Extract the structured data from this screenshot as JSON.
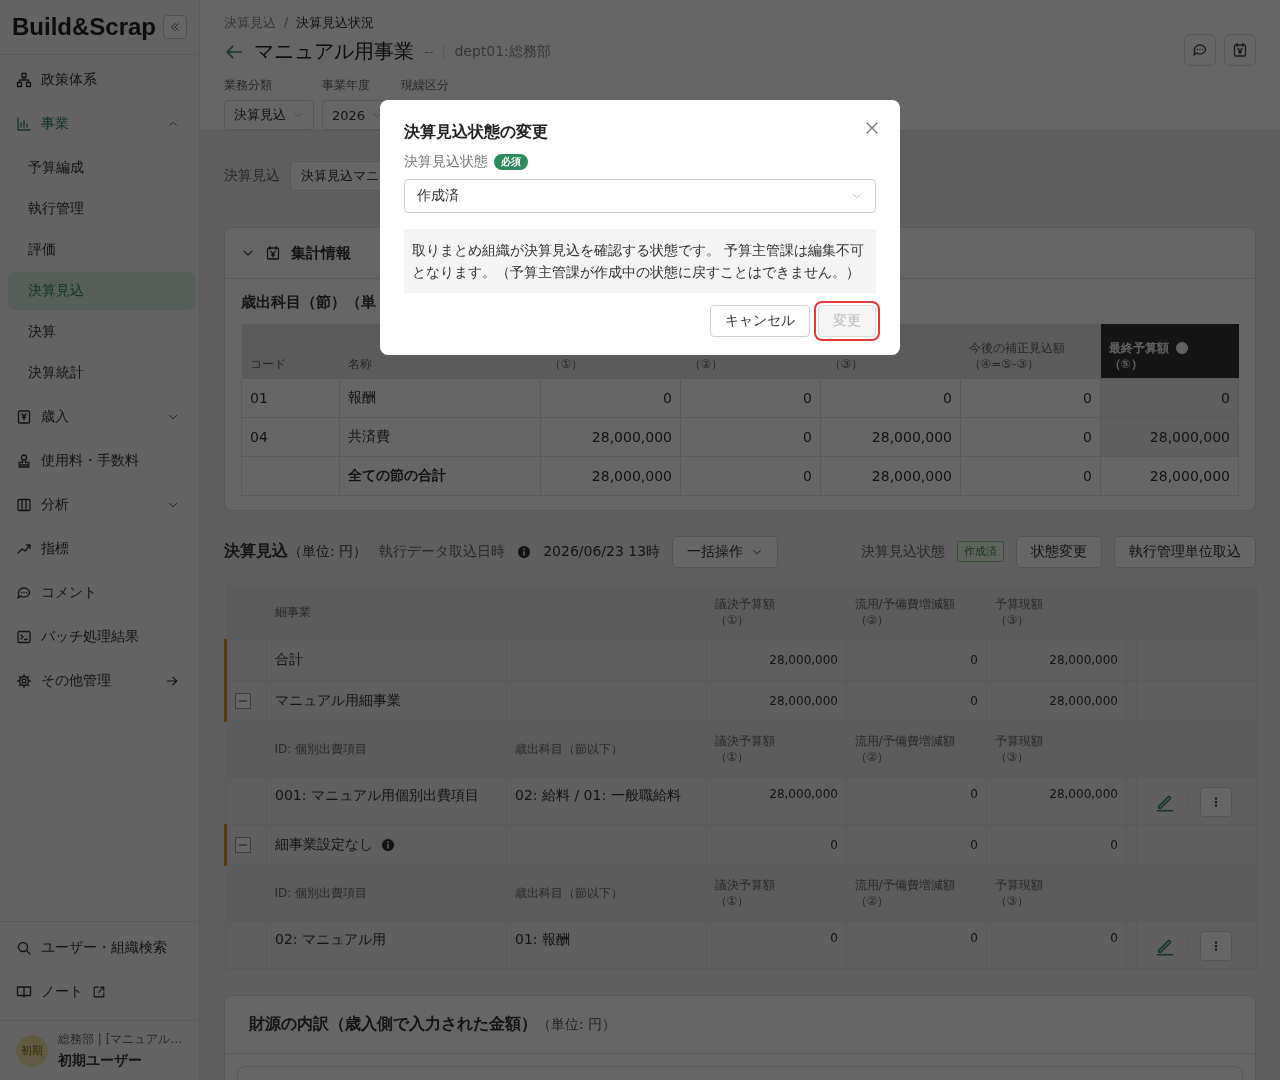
{
  "sidebar": {
    "logo": "Build&Scrap",
    "nav": [
      {
        "label": "政策体系",
        "kind": "page",
        "selected": false
      },
      {
        "label": "事業",
        "kind": "group",
        "expanded": true,
        "children": [
          {
            "label": "予算編成",
            "selected": false
          },
          {
            "label": "執行管理",
            "selected": false
          },
          {
            "label": "評価",
            "selected": false
          },
          {
            "label": "決算見込",
            "selected": true
          },
          {
            "label": "決算",
            "selected": false
          },
          {
            "label": "決算統計",
            "selected": false
          }
        ]
      },
      {
        "label": "歳入",
        "kind": "group",
        "expanded": false,
        "selected": false
      },
      {
        "label": "使用料・手数料",
        "kind": "page",
        "selected": false
      },
      {
        "label": "分析",
        "kind": "group",
        "expanded": false,
        "selected": false
      },
      {
        "label": "指標",
        "kind": "page",
        "selected": false
      },
      {
        "label": "コメント",
        "kind": "page",
        "selected": false
      },
      {
        "label": "バッチ処理結果",
        "kind": "page",
        "selected": false
      },
      {
        "label": "その他管理",
        "kind": "link",
        "selected": false
      }
    ],
    "footer_links": [
      {
        "label": "ユーザー・組織検索",
        "external": false
      },
      {
        "label": "ノート",
        "external": true
      }
    ],
    "user": {
      "avatar": "初期",
      "org": "総務部 | [マニュアル…",
      "name": "初期ユーザー"
    }
  },
  "header": {
    "breadcrumb": [
      "決算見込",
      "決算見込状況"
    ],
    "breadcrumb_separator": "/",
    "title": "マニュアル用事業",
    "separator": "--",
    "dept": "dept01:総務部",
    "filters": [
      {
        "label": "業務分類",
        "value": "決算見込"
      },
      {
        "label": "事業年度",
        "value": "2026"
      },
      {
        "label": "現繰区分"
      }
    ]
  },
  "selector": {
    "label": "決算見込",
    "value": "決算見込マニ"
  },
  "summary": {
    "title": "集計情報",
    "expanded": true,
    "subtitle": "歳出科目（節）（単",
    "columns": [
      {
        "title": "コード",
        "emphasized": false
      },
      {
        "title": "名称",
        "emphasized": false
      },
      {
        "sub": "（①）",
        "emphasized": false
      },
      {
        "sub": "（②）",
        "emphasized": false
      },
      {
        "sub": "（③）",
        "emphasized": false
      },
      {
        "title": "今後の補正見込額",
        "sub": "（④=⑤-③）",
        "emphasized": false
      },
      {
        "title": "最終予算額",
        "sub": "（⑤）",
        "info": true,
        "emphasized": true
      }
    ],
    "rows": [
      {
        "kind": "line",
        "code": "01",
        "name": "報酬",
        "values": [
          "0",
          "0",
          "0",
          "0",
          "0"
        ]
      },
      {
        "kind": "line",
        "code": "04",
        "name": "共済費",
        "values": [
          "28,000,000",
          "0",
          "28,000,000",
          "0",
          "28,000,000"
        ]
      },
      {
        "kind": "total",
        "name": "全ての節の合計",
        "values": [
          "28,000,000",
          "0",
          "28,000,000",
          "0",
          "28,000,000"
        ]
      }
    ]
  },
  "estimate": {
    "title": "決算見込",
    "unit": "（単位: 円）",
    "import_label": "執行データ取込日時",
    "import_time": "2026/06/23 13時",
    "bulk_button": "一括操作",
    "status_label": "決算見込状態",
    "status": "作成済",
    "buttons": [
      "状態変更",
      "執行管理単位取込"
    ],
    "columns": [
      {
        "title": "細事業"
      },
      {
        "title": "議決予算額",
        "sub": "（①）"
      },
      {
        "title": "流用/予備費増減額",
        "sub": "（②）"
      },
      {
        "title": "予算現額",
        "sub": "（③）"
      }
    ],
    "rows": [
      {
        "kind": "total",
        "name": "合計",
        "values": [
          "28,000,000",
          "0",
          "28,000,000"
        ]
      },
      {
        "kind": "group",
        "name": "マニュアル用細事業",
        "expanded": true,
        "info": false,
        "values": [
          "28,000,000",
          "0",
          "28,000,000"
        ]
      },
      {
        "kind": "subheader",
        "columns": [
          "ID: 個別出費項目",
          "歳出科目（節以下）"
        ],
        "amount_columns": [
          {
            "title": "議決予算額",
            "sub": "（①）"
          },
          {
            "title": "流用/予備費増減額",
            "sub": "（②）"
          },
          {
            "title": "予算現額",
            "sub": "（③）"
          }
        ]
      },
      {
        "kind": "item",
        "id": "001: マニュアル用個別出費項目",
        "account": "02: 給料 / 01: 一般職給料",
        "values": [
          "28,000,000",
          "0",
          "28,000,000"
        ]
      },
      {
        "kind": "group",
        "name": "細事業設定なし",
        "expanded": true,
        "info": true,
        "values": [
          "0",
          "0",
          "0"
        ]
      },
      {
        "kind": "subheader",
        "columns": [
          "ID: 個別出費項目",
          "歳出科目（節以下）"
        ],
        "amount_columns": [
          {
            "title": "議決予算額",
            "sub": "（①）"
          },
          {
            "title": "流用/予備費増減額",
            "sub": "（②）"
          },
          {
            "title": "予算現額",
            "sub": "（③）"
          }
        ]
      },
      {
        "kind": "item",
        "id": "02: マニュアル用",
        "account": "01: 報酬",
        "values": [
          "0",
          "0",
          "0"
        ]
      }
    ]
  },
  "funding": {
    "title": "財源の内訳（歳入側で入力された金額）",
    "unit": "（単位: 円）"
  },
  "dialog": {
    "title": "決算見込状態の変更",
    "field_label": "決算見込状態",
    "required": "必須",
    "value": "作成済",
    "description": "取りまとめ組織が決算見込を確認する状態です。 予算主管課は編集不可となります。（予算主管課が作成中の状態に戻すことはできません。）",
    "buttons": [
      {
        "label": "キャンセル",
        "kind": "secondary",
        "disabled": false,
        "focused": false
      },
      {
        "label": "変更",
        "kind": "primary",
        "disabled": true,
        "focused": true
      }
    ]
  }
}
